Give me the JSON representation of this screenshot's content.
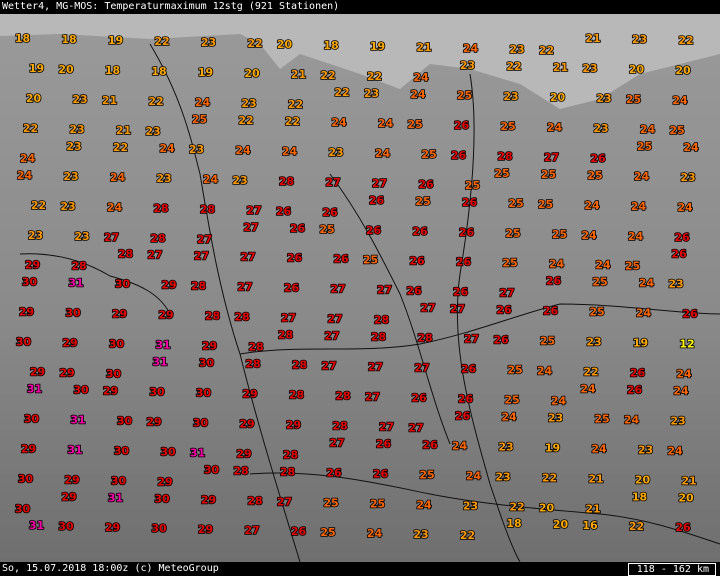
{
  "header": {
    "title": "Wetter4, MG-MOS: Temperaturmaximum 12stg (921 Stationen)"
  },
  "footer": {
    "date_credit": "So, 15.07.2018 18:00z (c) MeteoGroup",
    "scale": "118 - 162 km"
  },
  "colors": {
    "background": "#8f8f8f",
    "water": "#b8b8b8",
    "t_12": "#ffff00",
    "t_18_20": "#ffaa00",
    "t_21_23": "#ff9900",
    "t_24_25": "#ff6600",
    "t_26_30": "#e80000",
    "t_31": "#ff00aa"
  },
  "stations": [
    {
      "t": 18
    },
    {
      "t": 18
    },
    {
      "t": 19
    },
    {
      "t": 22
    },
    {
      "t": 23
    },
    {
      "t": 22
    },
    {
      "t": 20
    },
    {
      "t": 18
    },
    {
      "t": 19
    },
    {
      "t": 21
    },
    {
      "t": 24
    },
    {
      "t": 23
    },
    {
      "t": 22
    },
    {
      "t": 21
    },
    {
      "t": 23
    },
    {
      "t": 22
    },
    {
      "t": 19
    },
    {
      "t": 20
    },
    {
      "t": 18
    },
    {
      "t": 18
    },
    {
      "t": 19
    },
    {
      "t": 20
    },
    {
      "t": 21
    },
    {
      "t": 22
    },
    {
      "t": 22
    },
    {
      "t": 24
    },
    {
      "t": 23
    },
    {
      "t": 22
    },
    {
      "t": 21
    },
    {
      "t": 23
    },
    {
      "t": 20
    },
    {
      "t": 20
    },
    {
      "t": 20
    },
    {
      "t": 23
    },
    {
      "t": 21
    },
    {
      "t": 22
    },
    {
      "t": 24
    },
    {
      "t": 23
    },
    {
      "t": 22
    },
    {
      "t": 22
    },
    {
      "t": 23
    },
    {
      "t": 24
    },
    {
      "t": 25
    },
    {
      "t": 23
    },
    {
      "t": 20
    },
    {
      "t": 23
    },
    {
      "t": 25
    },
    {
      "t": 24
    },
    {
      "t": 22
    },
    {
      "t": 23
    },
    {
      "t": 21
    },
    {
      "t": 23
    },
    {
      "t": 25
    },
    {
      "t": 22
    },
    {
      "t": 22
    },
    {
      "t": 24
    },
    {
      "t": 24
    },
    {
      "t": 25
    },
    {
      "t": 26
    },
    {
      "t": 25
    },
    {
      "t": 24
    },
    {
      "t": 23
    },
    {
      "t": 24
    },
    {
      "t": 25
    },
    {
      "t": 24
    },
    {
      "t": 23
    },
    {
      "t": 22
    },
    {
      "t": 24
    },
    {
      "t": 23
    },
    {
      "t": 24
    },
    {
      "t": 24
    },
    {
      "t": 23
    },
    {
      "t": 24
    },
    {
      "t": 25
    },
    {
      "t": 26
    },
    {
      "t": 28
    },
    {
      "t": 27
    },
    {
      "t": 26
    },
    {
      "t": 25
    },
    {
      "t": 24
    },
    {
      "t": 24
    },
    {
      "t": 23
    },
    {
      "t": 24
    },
    {
      "t": 23
    },
    {
      "t": 24
    },
    {
      "t": 23
    },
    {
      "t": 28
    },
    {
      "t": 27
    },
    {
      "t": 27
    },
    {
      "t": 26
    },
    {
      "t": 25
    },
    {
      "t": 25
    },
    {
      "t": 25
    },
    {
      "t": 25
    },
    {
      "t": 24
    },
    {
      "t": 23
    },
    {
      "t": 22
    },
    {
      "t": 23
    },
    {
      "t": 24
    },
    {
      "t": 28
    },
    {
      "t": 28
    },
    {
      "t": 27
    },
    {
      "t": 26
    },
    {
      "t": 26
    },
    {
      "t": 26
    },
    {
      "t": 25
    },
    {
      "t": 26
    },
    {
      "t": 25
    },
    {
      "t": 25
    },
    {
      "t": 24
    },
    {
      "t": 24
    },
    {
      "t": 24
    },
    {
      "t": 23
    },
    {
      "t": 23
    },
    {
      "t": 27
    },
    {
      "t": 28
    },
    {
      "t": 27
    },
    {
      "t": 27
    },
    {
      "t": 26
    },
    {
      "t": 25
    },
    {
      "t": 26
    },
    {
      "t": 26
    },
    {
      "t": 26
    },
    {
      "t": 25
    },
    {
      "t": 25
    },
    {
      "t": 24
    },
    {
      "t": 24
    },
    {
      "t": 26
    },
    {
      "t": 29
    },
    {
      "t": 28
    },
    {
      "t": 28
    },
    {
      "t": 27
    },
    {
      "t": 27
    },
    {
      "t": 27
    },
    {
      "t": 26
    },
    {
      "t": 26
    },
    {
      "t": 25
    },
    {
      "t": 26
    },
    {
      "t": 26
    },
    {
      "t": 25
    },
    {
      "t": 24
    },
    {
      "t": 24
    },
    {
      "t": 25
    },
    {
      "t": 26
    },
    {
      "t": 30
    },
    {
      "t": 31
    },
    {
      "t": 30
    },
    {
      "t": 29
    },
    {
      "t": 28
    },
    {
      "t": 27
    },
    {
      "t": 26
    },
    {
      "t": 27
    },
    {
      "t": 27
    },
    {
      "t": 26
    },
    {
      "t": 26
    },
    {
      "t": 27
    },
    {
      "t": 26
    },
    {
      "t": 25
    },
    {
      "t": 24
    },
    {
      "t": 23
    },
    {
      "t": 29
    },
    {
      "t": 30
    },
    {
      "t": 29
    },
    {
      "t": 29
    },
    {
      "t": 28
    },
    {
      "t": 28
    },
    {
      "t": 27
    },
    {
      "t": 27
    },
    {
      "t": 28
    },
    {
      "t": 27
    },
    {
      "t": 27
    },
    {
      "t": 26
    },
    {
      "t": 26
    },
    {
      "t": 25
    },
    {
      "t": 24
    },
    {
      "t": 26
    },
    {
      "t": 30
    },
    {
      "t": 29
    },
    {
      "t": 30
    },
    {
      "t": 31
    },
    {
      "t": 29
    },
    {
      "t": 28
    },
    {
      "t": 28
    },
    {
      "t": 27
    },
    {
      "t": 28
    },
    {
      "t": 28
    },
    {
      "t": 27
    },
    {
      "t": 26
    },
    {
      "t": 25
    },
    {
      "t": 23
    },
    {
      "t": 19
    },
    {
      "t": 12
    },
    {
      "t": 29
    },
    {
      "t": 29
    },
    {
      "t": 30
    },
    {
      "t": 31
    },
    {
      "t": 30
    },
    {
      "t": 28
    },
    {
      "t": 28
    },
    {
      "t": 27
    },
    {
      "t": 27
    },
    {
      "t": 27
    },
    {
      "t": 26
    },
    {
      "t": 25
    },
    {
      "t": 24
    },
    {
      "t": 22
    },
    {
      "t": 26
    },
    {
      "t": 24
    },
    {
      "t": 31
    },
    {
      "t": 30
    },
    {
      "t": 29
    },
    {
      "t": 30
    },
    {
      "t": 30
    },
    {
      "t": 29
    },
    {
      "t": 28
    },
    {
      "t": 28
    },
    {
      "t": 27
    },
    {
      "t": 26
    },
    {
      "t": 26
    },
    {
      "t": 25
    },
    {
      "t": 24
    },
    {
      "t": 24
    },
    {
      "t": 26
    },
    {
      "t": 24
    },
    {
      "t": 30
    },
    {
      "t": 31
    },
    {
      "t": 30
    },
    {
      "t": 29
    },
    {
      "t": 30
    },
    {
      "t": 29
    },
    {
      "t": 29
    },
    {
      "t": 28
    },
    {
      "t": 27
    },
    {
      "t": 27
    },
    {
      "t": 26
    },
    {
      "t": 24
    },
    {
      "t": 23
    },
    {
      "t": 25
    },
    {
      "t": 24
    },
    {
      "t": 23
    },
    {
      "t": 29
    },
    {
      "t": 31
    },
    {
      "t": 30
    },
    {
      "t": 30
    },
    {
      "t": 31
    },
    {
      "t": 29
    },
    {
      "t": 28
    },
    {
      "t": 27
    },
    {
      "t": 26
    },
    {
      "t": 26
    },
    {
      "t": 24
    },
    {
      "t": 23
    },
    {
      "t": 19
    },
    {
      "t": 24
    },
    {
      "t": 23
    },
    {
      "t": 24
    },
    {
      "t": 30
    },
    {
      "t": 29
    },
    {
      "t": 30
    },
    {
      "t": 29
    },
    {
      "t": 30
    },
    {
      "t": 28
    },
    {
      "t": 28
    },
    {
      "t": 26
    },
    {
      "t": 26
    },
    {
      "t": 25
    },
    {
      "t": 24
    },
    {
      "t": 23
    },
    {
      "t": 22
    },
    {
      "t": 21
    },
    {
      "t": 20
    },
    {
      "t": 21
    },
    {
      "t": 30
    },
    {
      "t": 29
    },
    {
      "t": 31
    },
    {
      "t": 30
    },
    {
      "t": 29
    },
    {
      "t": 28
    },
    {
      "t": 27
    },
    {
      "t": 25
    },
    {
      "t": 25
    },
    {
      "t": 24
    },
    {
      "t": 23
    },
    {
      "t": 22
    },
    {
      "t": 20
    },
    {
      "t": 21
    },
    {
      "t": 18
    },
    {
      "t": 20
    },
    {
      "t": 31
    },
    {
      "t": 30
    },
    {
      "t": 29
    },
    {
      "t": 30
    },
    {
      "t": 29
    },
    {
      "t": 27
    },
    {
      "t": 26
    },
    {
      "t": 25
    },
    {
      "t": 24
    },
    {
      "t": 23
    },
    {
      "t": 22
    },
    {
      "t": 18
    },
    {
      "t": 20
    },
    {
      "t": 16
    },
    {
      "t": 22
    },
    {
      "t": 26
    }
  ]
}
